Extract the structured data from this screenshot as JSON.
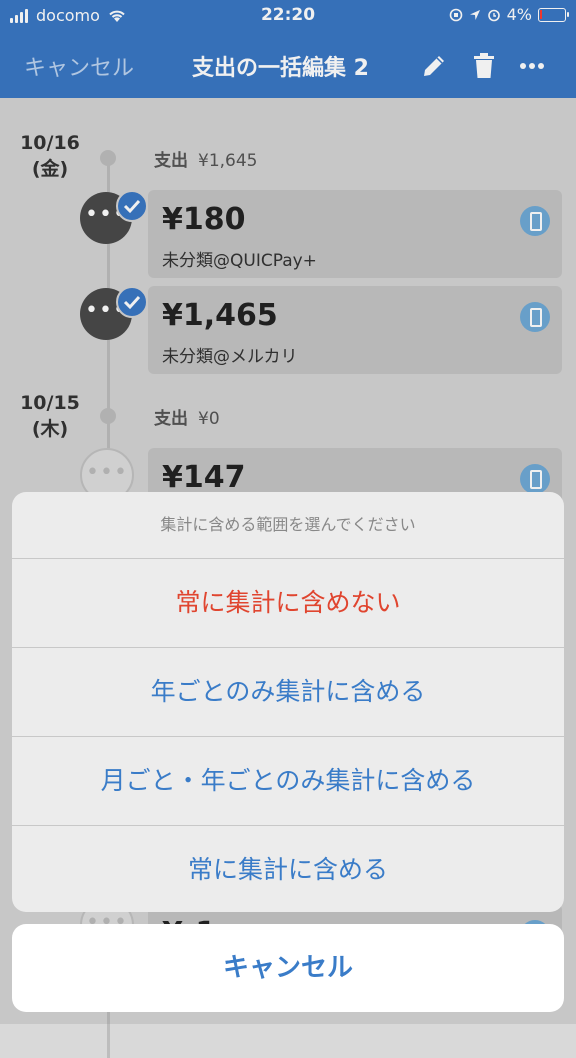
{
  "status_bar": {
    "carrier": "docomo",
    "time": "22:20",
    "battery": "4%"
  },
  "nav": {
    "cancel_label": "キャンセル",
    "title": "支出の一括編集 2",
    "icons": [
      "pencil-icon",
      "trash-icon",
      "more-icon"
    ]
  },
  "timeline": {
    "days": [
      {
        "date": "10/16",
        "weekday": "(金)",
        "summary_label": "支出",
        "summary_value": "¥1,645",
        "entries": [
          {
            "amount": "¥180",
            "category": "未分類@QUICPay+",
            "selected": true
          },
          {
            "amount": "¥1,465",
            "category": "未分類@メルカリ",
            "selected": true
          }
        ]
      },
      {
        "date": "10/15",
        "weekday": "(木)",
        "summary_label": "支出",
        "summary_value": "¥0",
        "entries": [
          {
            "amount": "¥147",
            "category": "",
            "selected": false
          },
          {
            "amount": "¥-1",
            "category": "",
            "selected": false
          }
        ]
      }
    ]
  },
  "action_sheet": {
    "title": "集計に含める範囲を選んでください",
    "options": [
      "常に集計に含めない",
      "年ごとのみ集計に含める",
      "月ごと・年ごとのみ集計に含める",
      "常に集計に含める"
    ],
    "cancel_label": "キャンセル"
  },
  "colors": {
    "header": "#3a77c4",
    "accent": "#3a7cc8",
    "destructive": "#e0452f"
  }
}
